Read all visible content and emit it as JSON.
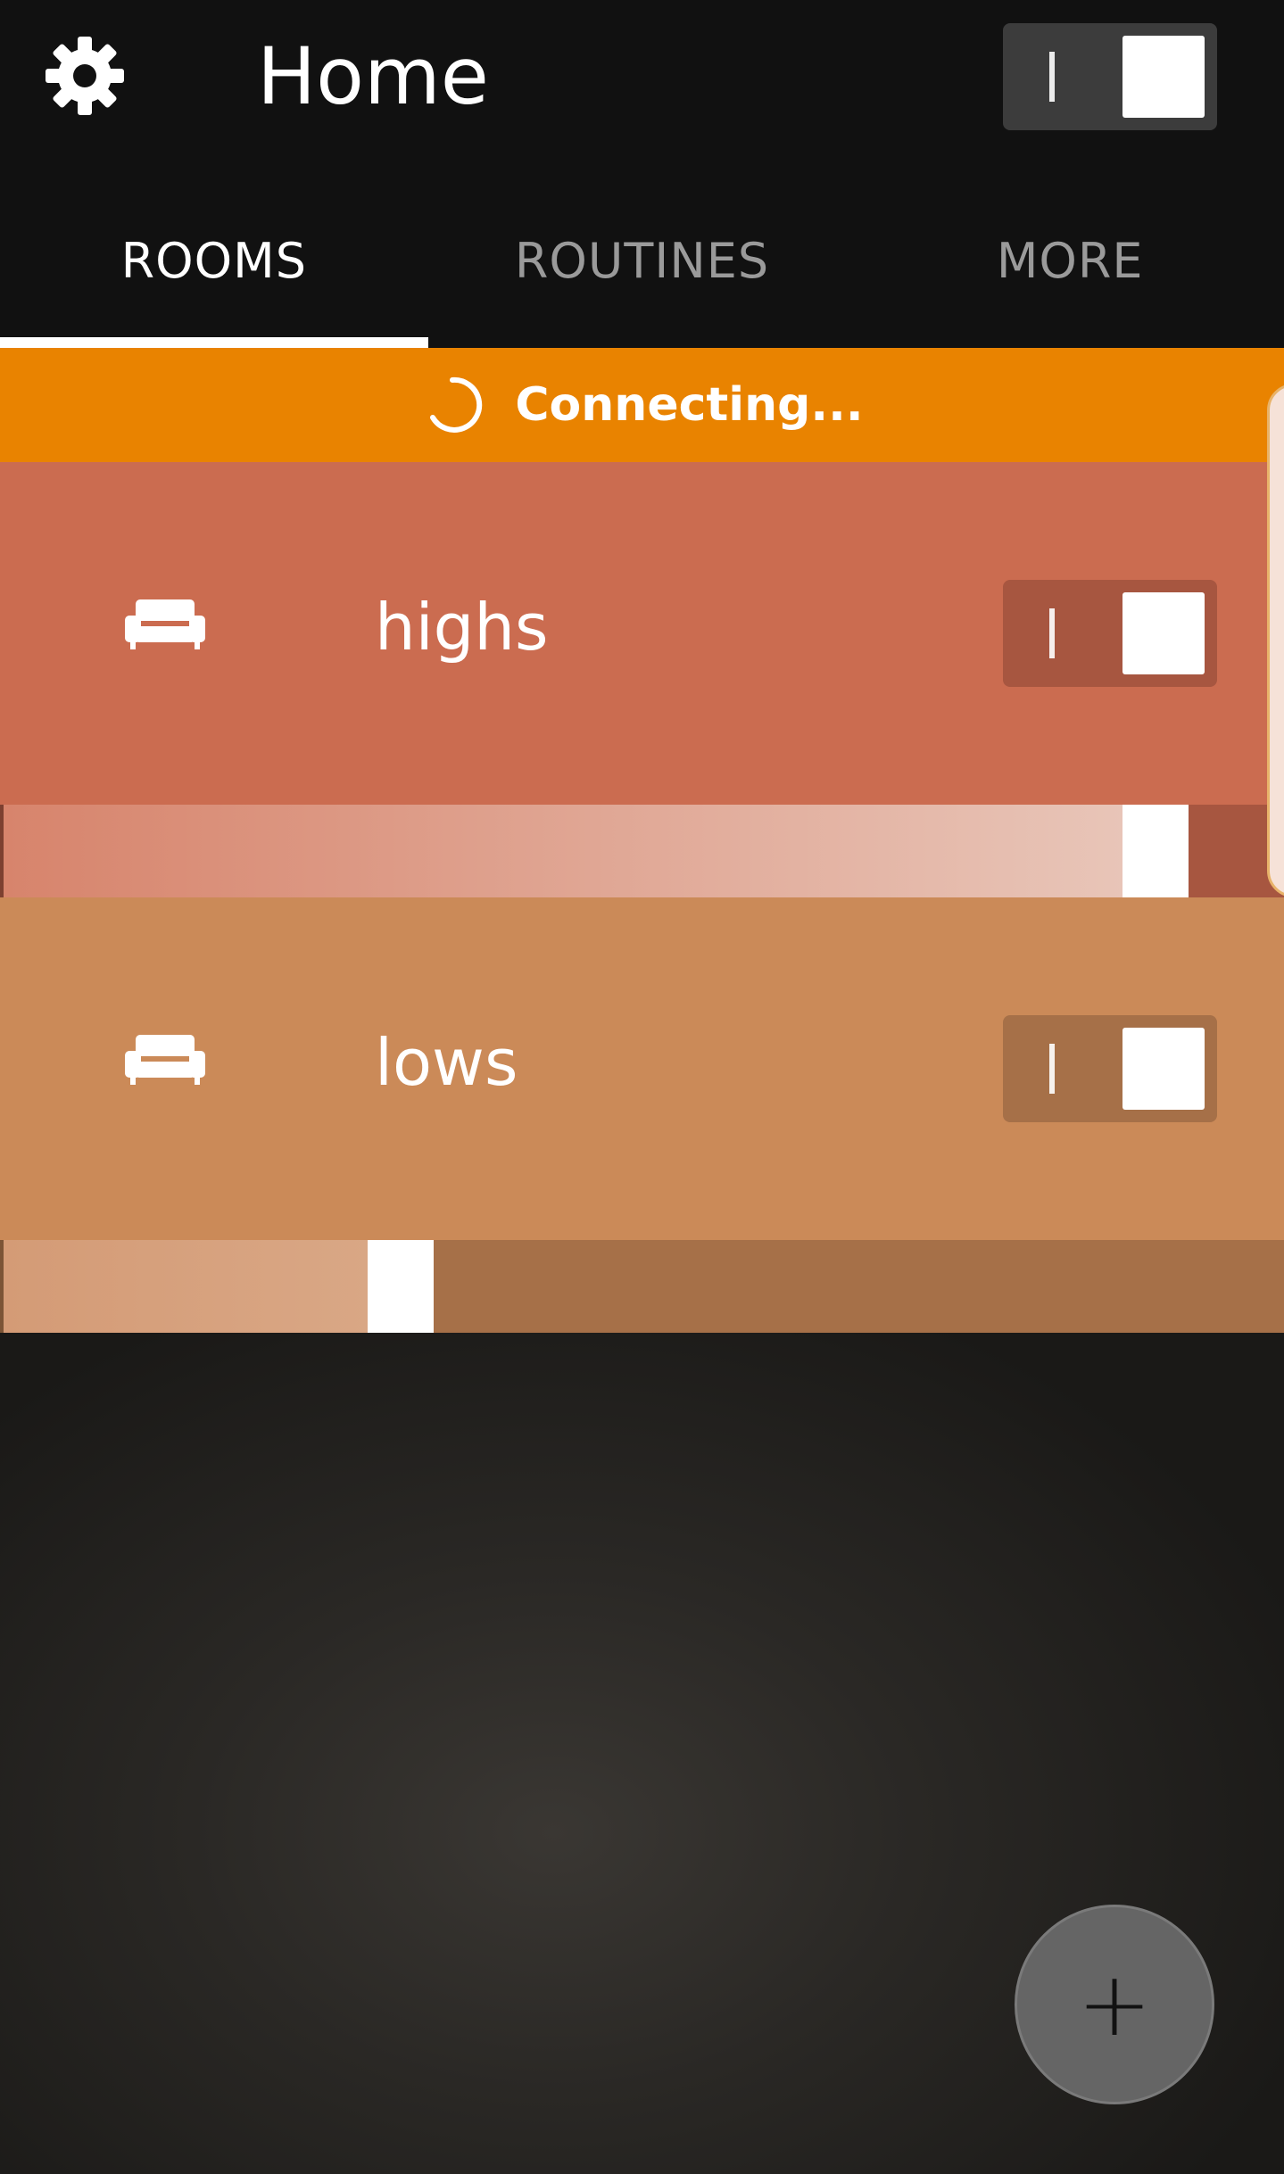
{
  "header": {
    "title": "Home",
    "settings_icon": "gear-icon",
    "master_toggle": {
      "state": "on",
      "on_mark": "I"
    }
  },
  "tabs": [
    {
      "label": "ROOMS",
      "active": true
    },
    {
      "label": "ROUTINES",
      "active": false
    },
    {
      "label": "MORE",
      "active": false
    }
  ],
  "banner": {
    "text": "Connecting...",
    "icon": "spinner-icon",
    "color": "#e98300"
  },
  "rooms": [
    {
      "name": "highs",
      "icon": "sofa-icon",
      "toggle": {
        "state": "on",
        "on_mark": "I"
      },
      "brightness_fraction": 0.9,
      "color": "#cb6c50"
    },
    {
      "name": "lows",
      "icon": "sofa-icon",
      "toggle": {
        "state": "on",
        "on_mark": "I"
      },
      "brightness_fraction": 0.3,
      "color": "#cb8a58"
    }
  ],
  "fab": {
    "label": "+",
    "icon": "plus-icon"
  }
}
